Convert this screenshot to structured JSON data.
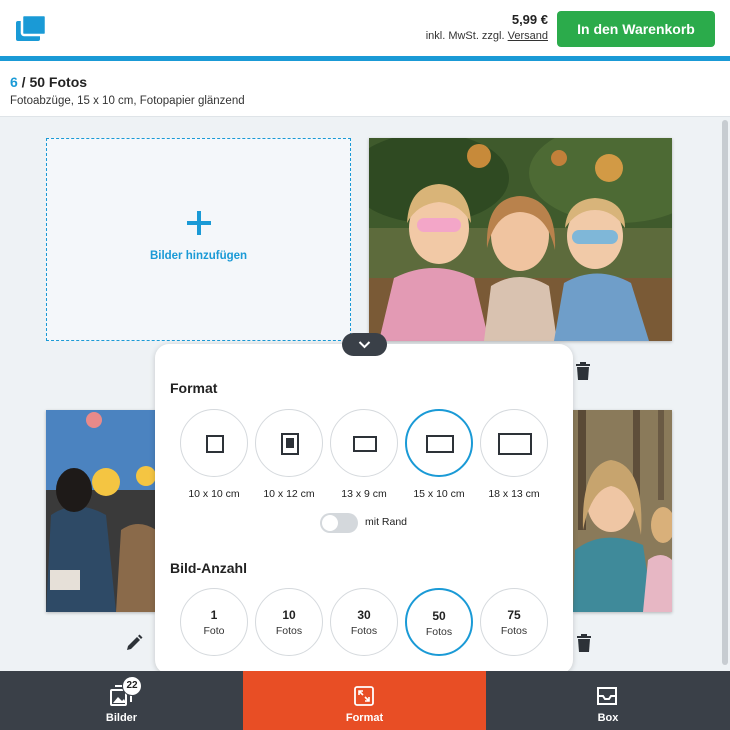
{
  "header": {
    "price": "5,99 €",
    "price_note": "inkl. MwSt. zzgl.",
    "shipping_link": "Versand",
    "cart_button": "In den Warenkorb",
    "accent_color": "#1a9ad6",
    "cart_color": "#2bab4b"
  },
  "order": {
    "current": "6",
    "total": " / 50 Fotos",
    "product": "Fotoabzüge, 15 x 10 cm, Fotopapier glänzend"
  },
  "editor": {
    "add_label": "Bilder hinzufügen"
  },
  "panel": {
    "format_title": "Format",
    "formats": [
      {
        "label": "10 x 10 cm",
        "selected": false,
        "icon": "square-format-icon"
      },
      {
        "label": "10 x 12 cm",
        "selected": false,
        "icon": "portrait-format-icon"
      },
      {
        "label": "13 x 9 cm",
        "selected": false,
        "icon": "landscape-small-format-icon"
      },
      {
        "label": "15 x 10 cm",
        "selected": true,
        "icon": "landscape-medium-format-icon"
      },
      {
        "label": "18 x 13 cm",
        "selected": false,
        "icon": "landscape-large-format-icon"
      }
    ],
    "border_toggle": "mit Rand",
    "border_on": false,
    "quantity_title": "Bild-Anzahl",
    "quantities": [
      {
        "num": "1",
        "unit": "Foto",
        "selected": false
      },
      {
        "num": "10",
        "unit": "Fotos",
        "selected": false
      },
      {
        "num": "30",
        "unit": "Fotos",
        "selected": false
      },
      {
        "num": "50",
        "unit": "Fotos",
        "selected": true
      },
      {
        "num": "75",
        "unit": "Fotos",
        "selected": false
      }
    ]
  },
  "nav": {
    "items": [
      {
        "label": "Bilder",
        "badge": "22",
        "icon": "images-icon"
      },
      {
        "label": "Format",
        "icon": "resize-icon",
        "active": true
      },
      {
        "label": "Box",
        "icon": "box-icon"
      }
    ],
    "active_color": "#e84e25"
  }
}
